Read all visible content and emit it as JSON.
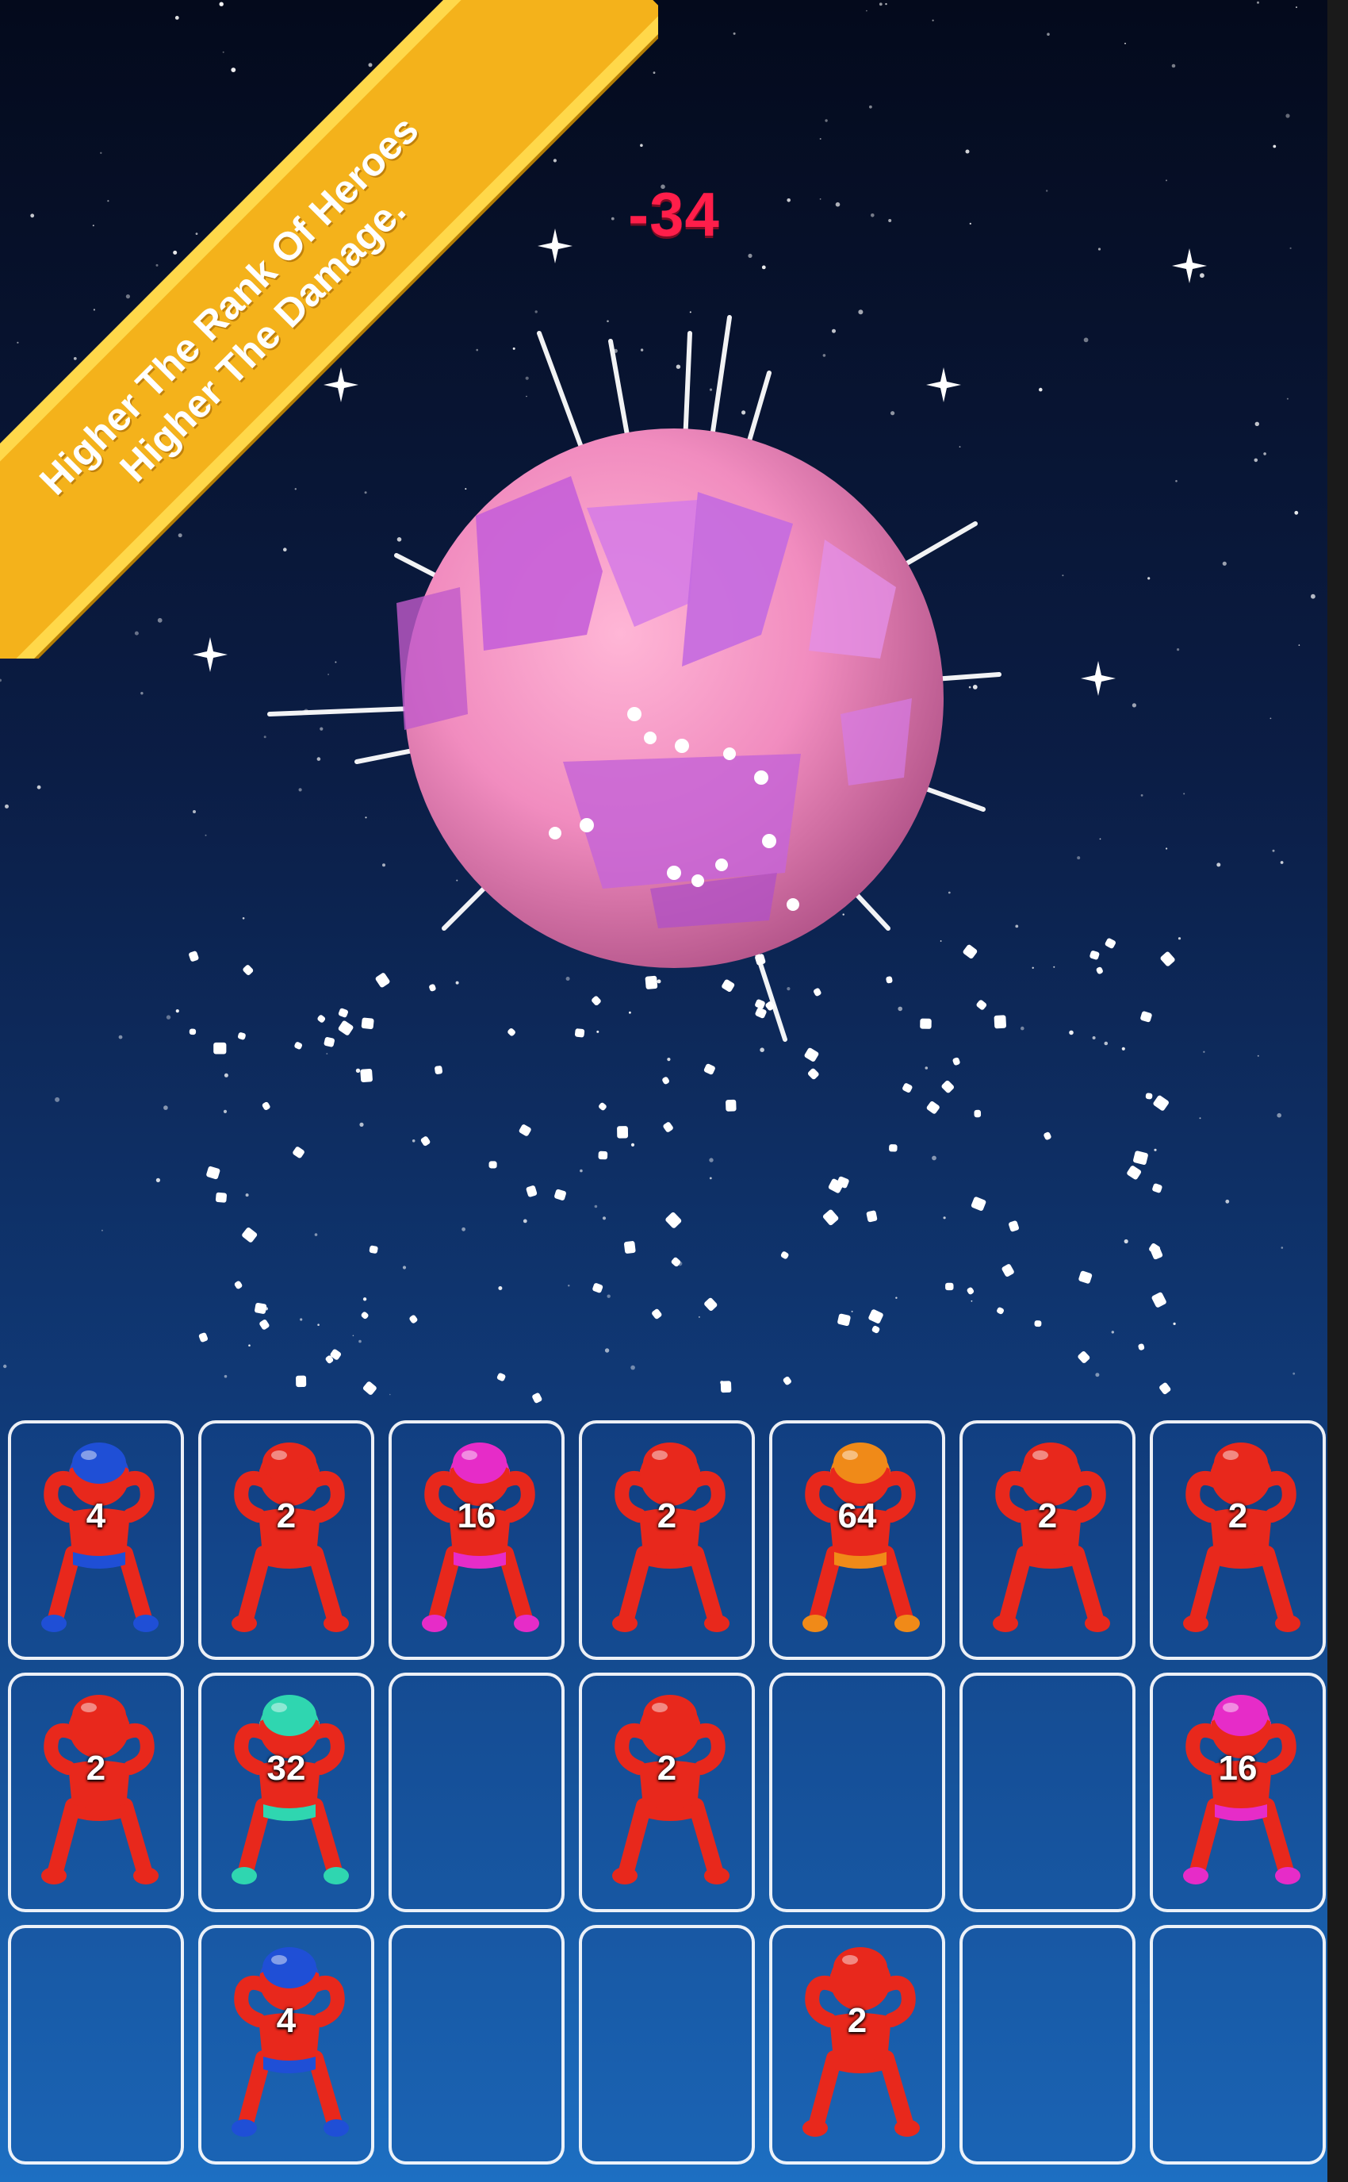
{
  "banner": {
    "line1": "Higher The Rank Of Heroes",
    "line2": "Higher The Damage."
  },
  "boss": {
    "damage_text": "-34",
    "icon": "planet-boss-icon"
  },
  "colors": {
    "banner": "#f4b21b",
    "damage": "#ff1e4a",
    "planet": "#f08ac0",
    "cell_border": "#ffffff"
  },
  "rank_colors": {
    "2": "#e8281c",
    "4": "#1f4fd6",
    "16": "#e62cc8",
    "32": "#2fd6b0",
    "64": "#f08a18"
  },
  "grid": {
    "columns": 7,
    "rows": [
      [
        4,
        2,
        16,
        2,
        64,
        2,
        2
      ],
      [
        2,
        32,
        null,
        2,
        null,
        null,
        16
      ],
      [
        null,
        4,
        null,
        null,
        2,
        null,
        null
      ]
    ]
  }
}
